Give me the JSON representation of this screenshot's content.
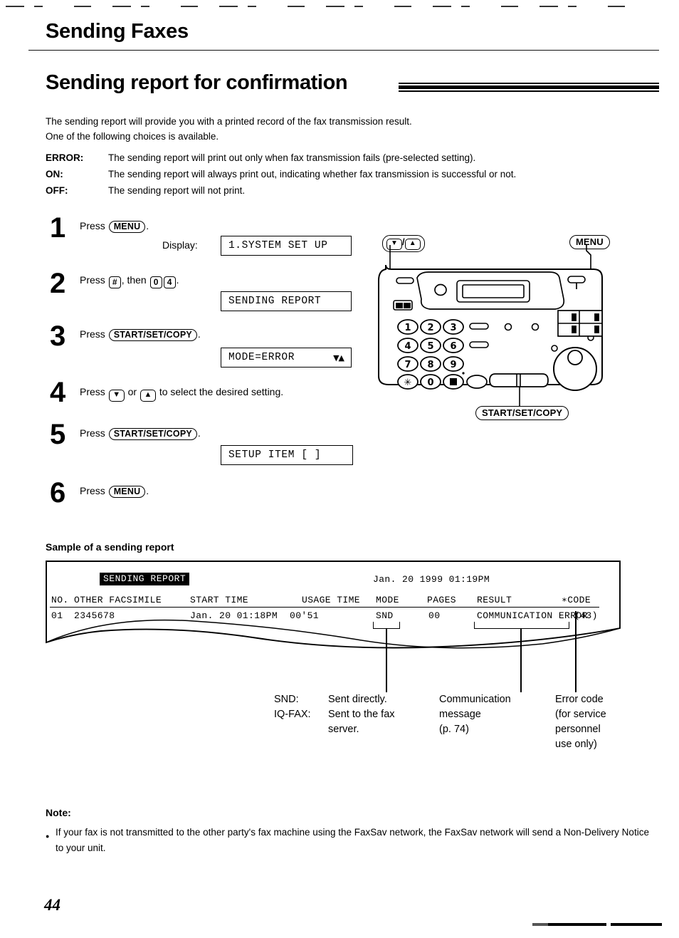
{
  "chapter_title": "Sending Faxes",
  "section_title": "Sending report for confirmation",
  "intro": {
    "line1": "The sending report will provide you with a printed record of the fax transmission result.",
    "line2": "One of the following choices is available."
  },
  "choices": [
    {
      "key": "ERROR:",
      "desc": "The sending report will print out only when fax transmission fails (pre-selected setting)."
    },
    {
      "key": "ON:",
      "desc": "The sending report will always print out, indicating whether fax transmission is successful or not."
    },
    {
      "key": "OFF:",
      "desc": "The sending report will not print."
    }
  ],
  "steps": [
    {
      "num": "1",
      "press_word": "Press",
      "key": "MENU",
      "period": ".",
      "display_label": "Display:",
      "lcd": "1.SYSTEM SET UP"
    },
    {
      "num": "2",
      "press_word": "Press",
      "key_hash": "#",
      "then_word": ", then",
      "key_0": "0",
      "key_4": "4",
      "period": ".",
      "lcd": "SENDING REPORT"
    },
    {
      "num": "3",
      "press_word": "Press",
      "key": "START/SET/COPY",
      "period": ".",
      "lcd": "MODE=ERROR",
      "lcd_arrows": "▼▲"
    },
    {
      "num": "4",
      "press_word": "Press",
      "key_down": "▼",
      "or_word": "or",
      "key_up": "▲",
      "tail": "to select the desired setting."
    },
    {
      "num": "5",
      "press_word": "Press",
      "key": "START/SET/COPY",
      "period": ".",
      "lcd": "SETUP ITEM [   ]"
    },
    {
      "num": "6",
      "press_word": "Press",
      "key": "MENU",
      "period": "."
    }
  ],
  "figure": {
    "callout_updown": "▼",
    "callout_updown_sep": "/",
    "callout_updown2": "▲",
    "callout_menu": "MENU",
    "callout_start": "START/SET/COPY",
    "keypad": [
      "1",
      "2",
      "3",
      "4",
      "5",
      "6",
      "7",
      "8",
      "9",
      "∗",
      "0",
      "□"
    ]
  },
  "sample": {
    "heading": "Sample of a sending report",
    "report_title": "SENDING REPORT",
    "timestamp": "Jan. 20 1999 01:19PM",
    "columns_line": "NO. OTHER FACSIMILE  START TIME      USAGE TIME MODE",
    "col_no": "NO.",
    "col_other": "OTHER FACSIMILE",
    "col_start": "START TIME",
    "col_usage": "USAGE TIME",
    "col_mode": "MODE",
    "col_pages": "PAGES",
    "col_result": "RESULT",
    "col_code": "∗CODE",
    "row": {
      "no": "01",
      "other_facsimile": "2345678",
      "start_time": "Jan. 20 01:18PM",
      "usage_time": "00'51",
      "mode": "SND",
      "pages": "00",
      "result": "COMMUNICATION ERROR",
      "code": "(43)"
    }
  },
  "callouts": {
    "mode": {
      "k1": "SND:",
      "v1": "Sent directly.",
      "k2": "IQ-FAX:",
      "v2": "Sent to the fax",
      "v2b": "server."
    },
    "message": {
      "l1": "Communication",
      "l2": "message",
      "l3": "(p. 74)"
    },
    "code": {
      "l1": "Error code",
      "l2": "(for service",
      "l3": "personnel",
      "l4": "use only)"
    }
  },
  "note": {
    "heading": "Note:",
    "bullet": "●",
    "text": "If your fax is not transmitted to the other party's fax machine using the FaxSav network, the FaxSav network will send a Non-Delivery Notice to your unit."
  },
  "page_number": "44"
}
